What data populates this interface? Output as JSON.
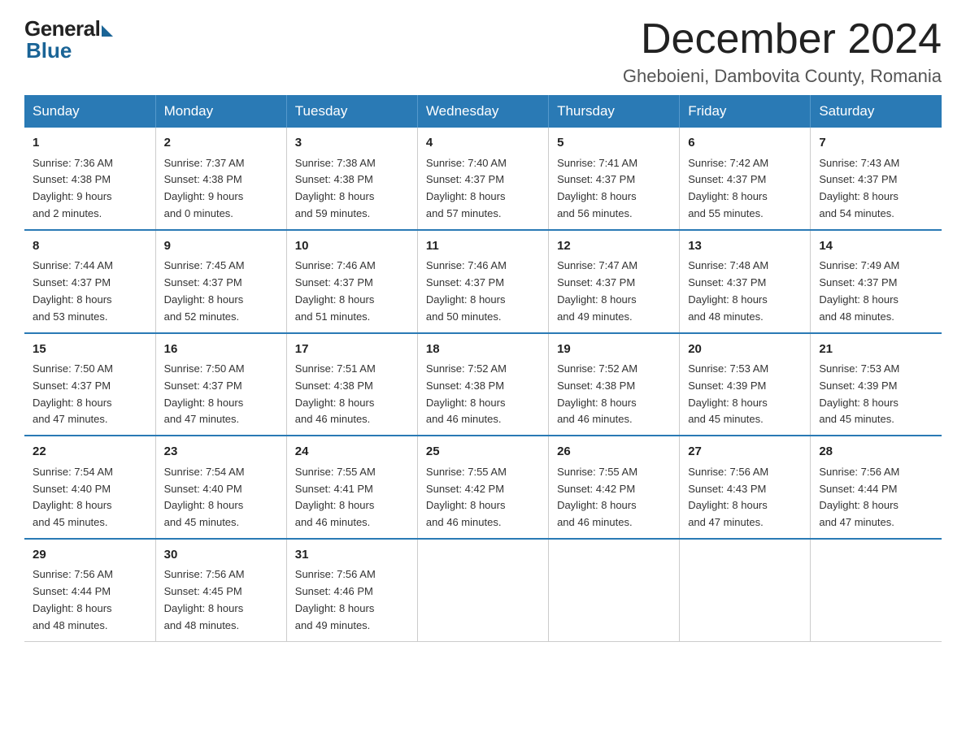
{
  "header": {
    "logo_general": "General",
    "logo_blue": "Blue",
    "month_title": "December 2024",
    "location": "Gheboieni, Dambovita County, Romania"
  },
  "weekdays": [
    "Sunday",
    "Monday",
    "Tuesday",
    "Wednesday",
    "Thursday",
    "Friday",
    "Saturday"
  ],
  "weeks": [
    [
      {
        "day": "1",
        "sunrise": "7:36 AM",
        "sunset": "4:38 PM",
        "daylight": "9 hours and 2 minutes."
      },
      {
        "day": "2",
        "sunrise": "7:37 AM",
        "sunset": "4:38 PM",
        "daylight": "9 hours and 0 minutes."
      },
      {
        "day": "3",
        "sunrise": "7:38 AM",
        "sunset": "4:38 PM",
        "daylight": "8 hours and 59 minutes."
      },
      {
        "day": "4",
        "sunrise": "7:40 AM",
        "sunset": "4:37 PM",
        "daylight": "8 hours and 57 minutes."
      },
      {
        "day": "5",
        "sunrise": "7:41 AM",
        "sunset": "4:37 PM",
        "daylight": "8 hours and 56 minutes."
      },
      {
        "day": "6",
        "sunrise": "7:42 AM",
        "sunset": "4:37 PM",
        "daylight": "8 hours and 55 minutes."
      },
      {
        "day": "7",
        "sunrise": "7:43 AM",
        "sunset": "4:37 PM",
        "daylight": "8 hours and 54 minutes."
      }
    ],
    [
      {
        "day": "8",
        "sunrise": "7:44 AM",
        "sunset": "4:37 PM",
        "daylight": "8 hours and 53 minutes."
      },
      {
        "day": "9",
        "sunrise": "7:45 AM",
        "sunset": "4:37 PM",
        "daylight": "8 hours and 52 minutes."
      },
      {
        "day": "10",
        "sunrise": "7:46 AM",
        "sunset": "4:37 PM",
        "daylight": "8 hours and 51 minutes."
      },
      {
        "day": "11",
        "sunrise": "7:46 AM",
        "sunset": "4:37 PM",
        "daylight": "8 hours and 50 minutes."
      },
      {
        "day": "12",
        "sunrise": "7:47 AM",
        "sunset": "4:37 PM",
        "daylight": "8 hours and 49 minutes."
      },
      {
        "day": "13",
        "sunrise": "7:48 AM",
        "sunset": "4:37 PM",
        "daylight": "8 hours and 48 minutes."
      },
      {
        "day": "14",
        "sunrise": "7:49 AM",
        "sunset": "4:37 PM",
        "daylight": "8 hours and 48 minutes."
      }
    ],
    [
      {
        "day": "15",
        "sunrise": "7:50 AM",
        "sunset": "4:37 PM",
        "daylight": "8 hours and 47 minutes."
      },
      {
        "day": "16",
        "sunrise": "7:50 AM",
        "sunset": "4:37 PM",
        "daylight": "8 hours and 47 minutes."
      },
      {
        "day": "17",
        "sunrise": "7:51 AM",
        "sunset": "4:38 PM",
        "daylight": "8 hours and 46 minutes."
      },
      {
        "day": "18",
        "sunrise": "7:52 AM",
        "sunset": "4:38 PM",
        "daylight": "8 hours and 46 minutes."
      },
      {
        "day": "19",
        "sunrise": "7:52 AM",
        "sunset": "4:38 PM",
        "daylight": "8 hours and 46 minutes."
      },
      {
        "day": "20",
        "sunrise": "7:53 AM",
        "sunset": "4:39 PM",
        "daylight": "8 hours and 45 minutes."
      },
      {
        "day": "21",
        "sunrise": "7:53 AM",
        "sunset": "4:39 PM",
        "daylight": "8 hours and 45 minutes."
      }
    ],
    [
      {
        "day": "22",
        "sunrise": "7:54 AM",
        "sunset": "4:40 PM",
        "daylight": "8 hours and 45 minutes."
      },
      {
        "day": "23",
        "sunrise": "7:54 AM",
        "sunset": "4:40 PM",
        "daylight": "8 hours and 45 minutes."
      },
      {
        "day": "24",
        "sunrise": "7:55 AM",
        "sunset": "4:41 PM",
        "daylight": "8 hours and 46 minutes."
      },
      {
        "day": "25",
        "sunrise": "7:55 AM",
        "sunset": "4:42 PM",
        "daylight": "8 hours and 46 minutes."
      },
      {
        "day": "26",
        "sunrise": "7:55 AM",
        "sunset": "4:42 PM",
        "daylight": "8 hours and 46 minutes."
      },
      {
        "day": "27",
        "sunrise": "7:56 AM",
        "sunset": "4:43 PM",
        "daylight": "8 hours and 47 minutes."
      },
      {
        "day": "28",
        "sunrise": "7:56 AM",
        "sunset": "4:44 PM",
        "daylight": "8 hours and 47 minutes."
      }
    ],
    [
      {
        "day": "29",
        "sunrise": "7:56 AM",
        "sunset": "4:44 PM",
        "daylight": "8 hours and 48 minutes."
      },
      {
        "day": "30",
        "sunrise": "7:56 AM",
        "sunset": "4:45 PM",
        "daylight": "8 hours and 48 minutes."
      },
      {
        "day": "31",
        "sunrise": "7:56 AM",
        "sunset": "4:46 PM",
        "daylight": "8 hours and 49 minutes."
      },
      null,
      null,
      null,
      null
    ]
  ],
  "labels": {
    "sunrise": "Sunrise:",
    "sunset": "Sunset:",
    "daylight": "Daylight:"
  }
}
